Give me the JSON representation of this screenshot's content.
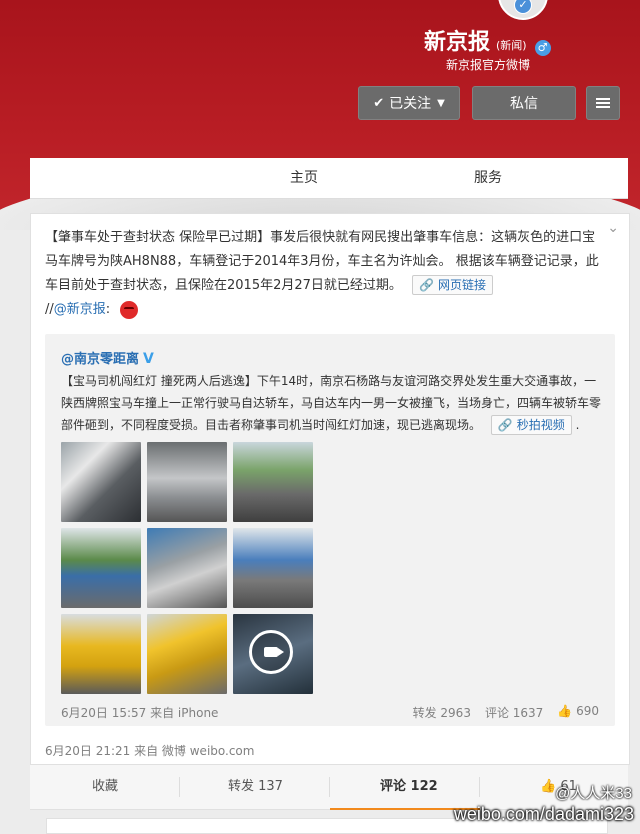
{
  "header": {
    "name": "新京报",
    "tag": "(新闻)",
    "subtitle": "新京报官方微博",
    "follow_label": "已关注",
    "message_label": "私信",
    "gender_symbol": "♂",
    "verified_symbol": "✓"
  },
  "nav": {
    "home": "主页",
    "service": "服务"
  },
  "post": {
    "text": "【肇事车处于查封状态 保险早已过期】事发后很快就有网民搜出肇事车信息：这辆灰色的进口宝马车牌号为陕AH8N88，车辆登记于2014年3月份，车主名为许灿会。 根据该车辆登记记录，此车目前处于查封状态，且保险在2015年2月27日就已经过期。",
    "link_label": "网页链接",
    "mention_prefix": "//",
    "mention": "@新京报",
    "mention_suffix": ":",
    "meta": "6月20日 21:21 来自 微博 weibo.com"
  },
  "repost": {
    "author": "@南京零距离",
    "text": "【宝马司机闯红灯 撞死两人后逃逸】下午14时，南京石杨路与友谊河路交界处发生重大交通事故，一陕西牌照宝马车撞上一正常行驶马自达轿车，马自达车内一男一女被撞飞，当场身亡，四辆车被轿车零部件砸到，不同程度受损。目击者称肇事司机当时闯红灯加速，现已逃离现场。",
    "video_label": "秒拍视频",
    "trailing": ".",
    "meta": "6月20日 15:57 来自 iPhone",
    "forward": "转发 2963",
    "comment": "评论 1637",
    "like": "690"
  },
  "actions": {
    "favorite": "收藏",
    "forward": "转发 137",
    "comment": "评论 122",
    "like": "61"
  },
  "watermark": {
    "line1": "@人人米33",
    "line2": "weibo.com/dadami323"
  },
  "colors": {
    "brand_red": "#b81d24",
    "link_blue": "#2a6fb3",
    "accent_orange": "#f28a1d"
  }
}
